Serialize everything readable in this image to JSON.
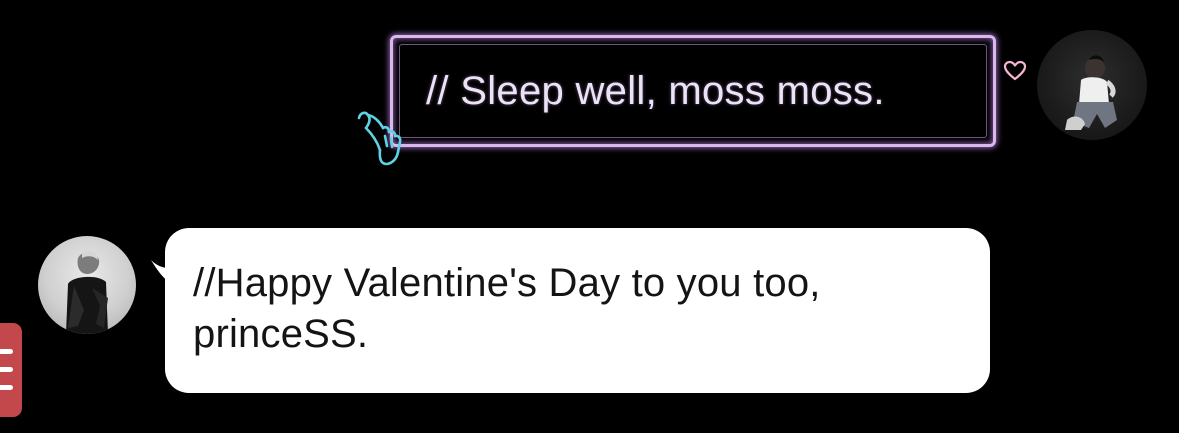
{
  "messages": {
    "outgoing": {
      "text": "// Sleep well, moss moss."
    },
    "incoming": {
      "text": "//Happy Valentine's Day to you too,\nprinceSS."
    }
  },
  "icons": {
    "outgoing_decoration_heart": "heart-icon",
    "outgoing_decoration_hand": "finger-heart-hand-icon",
    "menu": "menu-icon"
  },
  "colors": {
    "background": "#000000",
    "outgoing_border": "#d9b8ea",
    "outgoing_glow": "#b278dc",
    "outgoing_text": "#ece2f6",
    "incoming_bubble": "#ffffff",
    "incoming_text": "#141414",
    "hand_outline": "#5fd3e6",
    "menu_tab": "#c2484c"
  }
}
